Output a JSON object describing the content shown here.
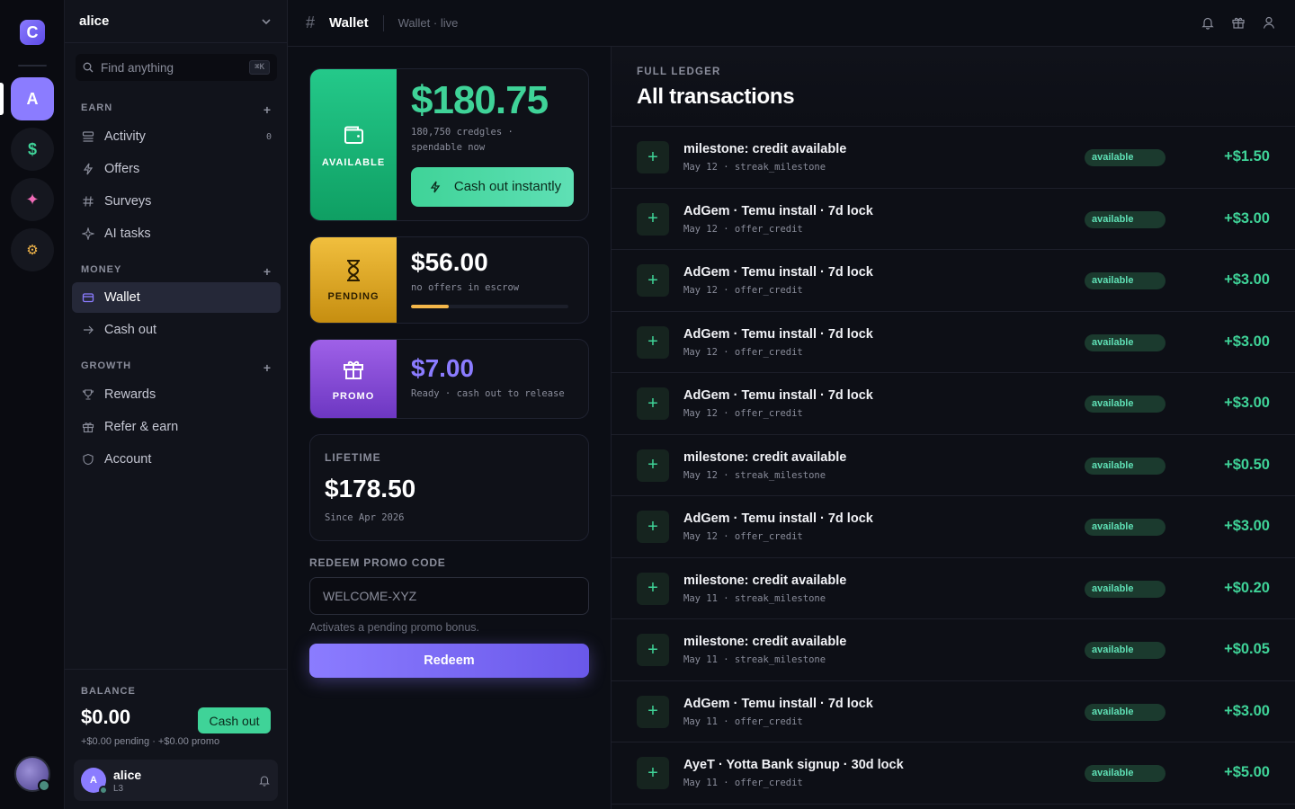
{
  "rail": {
    "logo": "C",
    "items": [
      {
        "glyph": "A",
        "color": "#ffffff"
      },
      {
        "glyph": "$",
        "color": "#3fd398"
      },
      {
        "glyph": "✦",
        "color": "#f06bb7"
      },
      {
        "glyph": "⚙",
        "color": "#f4b74a"
      }
    ]
  },
  "sidebar": {
    "workspace": "alice",
    "search_placeholder": "Find anything",
    "search_shortcut": "⌘K",
    "sections": [
      {
        "title": "EARN",
        "items": [
          {
            "label": "Activity",
            "icon": "list-icon",
            "count": "0"
          },
          {
            "label": "Offers",
            "icon": "bolt-icon"
          },
          {
            "label": "Surveys",
            "icon": "hash-icon"
          },
          {
            "label": "AI tasks",
            "icon": "sparkle-icon"
          }
        ]
      },
      {
        "title": "MONEY",
        "items": [
          {
            "label": "Wallet",
            "icon": "wallet-icon",
            "active": true
          },
          {
            "label": "Cash out",
            "icon": "arrow-right-icon"
          }
        ]
      },
      {
        "title": "GROWTH",
        "items": [
          {
            "label": "Rewards",
            "icon": "trophy-icon"
          },
          {
            "label": "Refer & earn",
            "icon": "gift-icon"
          },
          {
            "label": "Account",
            "icon": "shield-icon"
          }
        ]
      }
    ],
    "balance": {
      "label": "BALANCE",
      "amount": "$0.00",
      "cashout_label": "Cash out",
      "sub": "+$0.00 pending  ·  +$0.00 promo"
    },
    "user": {
      "initial": "A",
      "name": "alice",
      "level": "L3"
    }
  },
  "topbar": {
    "title": "Wallet",
    "subtitle": "Wallet · live"
  },
  "wallet": {
    "available": {
      "label": "AVAILABLE",
      "amount": "$180.75",
      "sub": "180,750 credgles · spendable now",
      "button": "Cash out instantly",
      "color": "#3fd398"
    },
    "pending": {
      "label": "PENDING",
      "amount": "$56.00",
      "sub": "no offers in escrow",
      "progress": 0.24,
      "color": "#f4b74a"
    },
    "promo": {
      "label": "PROMO",
      "amount": "$7.00",
      "sub": "Ready · cash out to release",
      "color": "#8b7cff"
    },
    "lifetime": {
      "label": "LIFETIME",
      "amount": "$178.50",
      "since": "Since Apr 2026"
    },
    "redeem": {
      "label": "REDEEM PROMO CODE",
      "placeholder": "WELCOME-XYZ",
      "help": "Activates a pending promo bonus.",
      "button": "Redeem"
    }
  },
  "ledger": {
    "kicker": "FULL LEDGER",
    "title": "All transactions",
    "rows": [
      {
        "title": "milestone: credit available",
        "meta": "May 12 · streak_milestone",
        "status": "available",
        "amount": "+$1.50"
      },
      {
        "title": "AdGem · Temu install · 7d lock",
        "meta": "May 12 · offer_credit",
        "status": "available",
        "amount": "+$3.00"
      },
      {
        "title": "AdGem · Temu install · 7d lock",
        "meta": "May 12 · offer_credit",
        "status": "available",
        "amount": "+$3.00"
      },
      {
        "title": "AdGem · Temu install · 7d lock",
        "meta": "May 12 · offer_credit",
        "status": "available",
        "amount": "+$3.00"
      },
      {
        "title": "AdGem · Temu install · 7d lock",
        "meta": "May 12 · offer_credit",
        "status": "available",
        "amount": "+$3.00"
      },
      {
        "title": "milestone: credit available",
        "meta": "May 12 · streak_milestone",
        "status": "available",
        "amount": "+$0.50"
      },
      {
        "title": "AdGem · Temu install · 7d lock",
        "meta": "May 12 · offer_credit",
        "status": "available",
        "amount": "+$3.00"
      },
      {
        "title": "milestone: credit available",
        "meta": "May 11 · streak_milestone",
        "status": "available",
        "amount": "+$0.20"
      },
      {
        "title": "milestone: credit available",
        "meta": "May 11 · streak_milestone",
        "status": "available",
        "amount": "+$0.05"
      },
      {
        "title": "AdGem · Temu install · 7d lock",
        "meta": "May 11 · offer_credit",
        "status": "available",
        "amount": "+$3.00"
      },
      {
        "title": "AyeT · Yotta Bank signup · 30d lock",
        "meta": "May 11 · offer_credit",
        "status": "available",
        "amount": "+$5.00"
      }
    ]
  }
}
